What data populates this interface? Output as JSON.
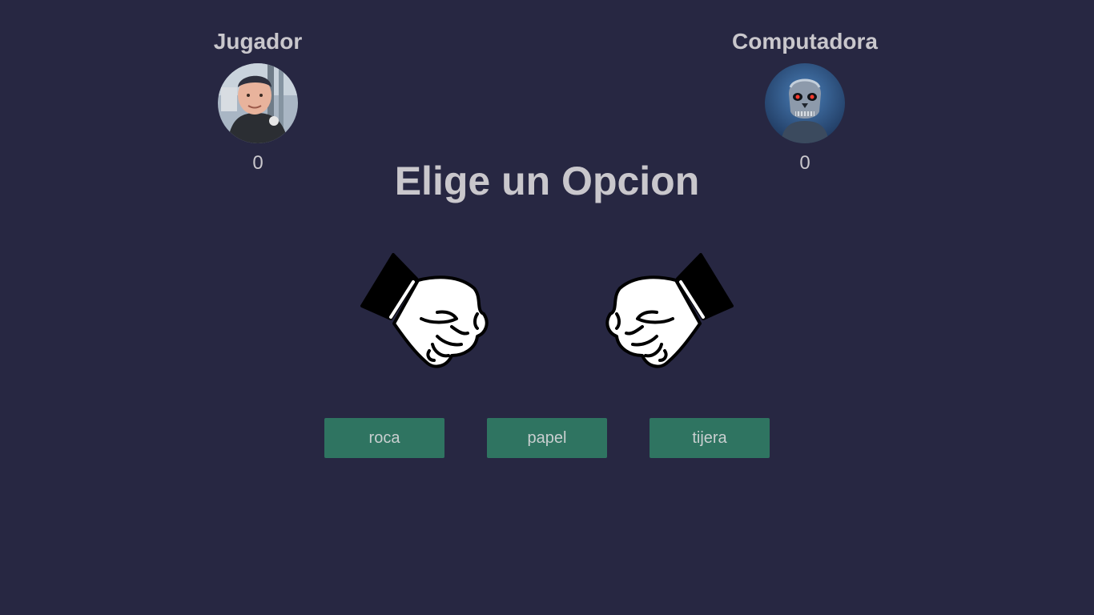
{
  "players": {
    "human": {
      "name": "Jugador",
      "score": "0",
      "avatar_icon": "child-portrait-avatar"
    },
    "computer": {
      "name": "Computadora",
      "score": "0",
      "avatar_icon": "robot-skull-avatar"
    }
  },
  "prompt": "Elige un Opcion",
  "hands": {
    "left_icon": "fist-icon",
    "right_icon": "fist-icon"
  },
  "choices": {
    "rock": "roca",
    "paper": "papel",
    "scissors": "tijera"
  },
  "colors": {
    "background": "#272742",
    "text": "#c9c7cc",
    "button": "#2f7461"
  }
}
